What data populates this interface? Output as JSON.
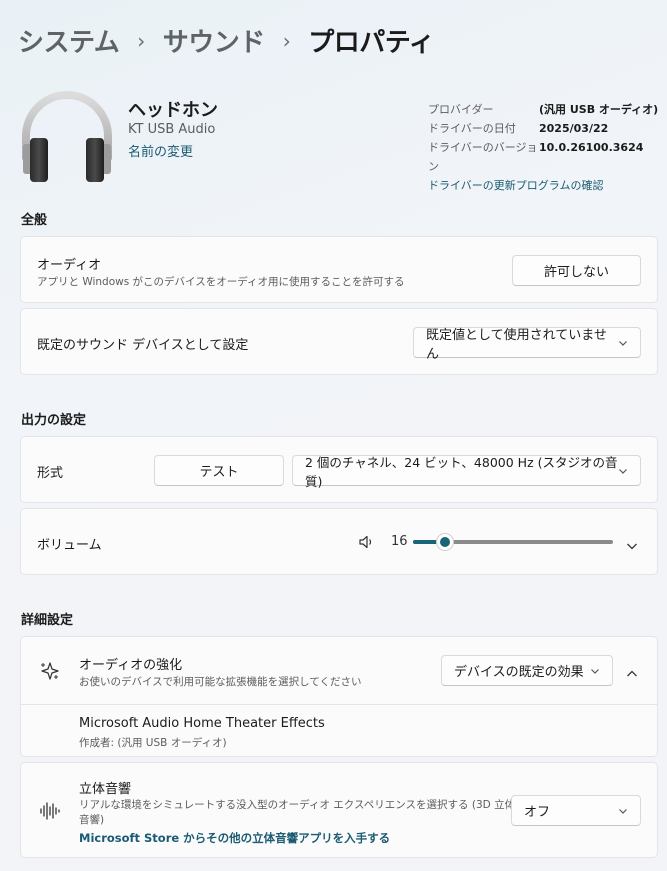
{
  "breadcrumb": {
    "item1": "システム",
    "item2": "サウンド",
    "current": "プロパティ",
    "separator": "›"
  },
  "device": {
    "name": "ヘッドホン",
    "model": "KT USB Audio",
    "rename_link": "名前の変更"
  },
  "properties": {
    "provider_label": "プロバイダー",
    "provider_value": "(汎用 USB オーディオ)",
    "date_label": "ドライバーの日付",
    "date_value": "2025/03/22",
    "version_label": "ドライバーのバージョン",
    "version_value": "10.0.26100.3624",
    "update_link": "ドライバーの更新プログラムの確認"
  },
  "general": {
    "heading": "全般",
    "audio_title": "オーディオ",
    "audio_desc": "アプリと Windows がこのデバイスをオーディオ用に使用することを許可する",
    "deny_button": "許可しない",
    "default_title": "既定のサウンド デバイスとして設定",
    "default_value": "既定値として使用されていません"
  },
  "output": {
    "heading": "出力の設定",
    "format_title": "形式",
    "test_button": "テスト",
    "format_value": "2 個のチャネル、24 ビット、48000 Hz (スタジオの音質)",
    "volume_title": "ボリューム",
    "volume_value": "16",
    "volume_level": 16
  },
  "advanced": {
    "heading": "詳細設定",
    "enh_title": "オーディオの強化",
    "enh_desc": "お使いのデバイスで利用可能な拡張機能を選択してください",
    "enh_value": "デバイスの既定の効果",
    "effect_name": "Microsoft Audio Home Theater Effects",
    "effect_author": "作成者: (汎用 USB オーディオ)",
    "spatial_title": "立体音響",
    "spatial_desc_1": "リアルな環境をシミュレートする没入型のオーディオ エクスペリエンスを選択する (3D 立体",
    "spatial_desc_2": "音響)",
    "spatial_link": "Microsoft Store からその他の立体音響アプリを入手する",
    "spatial_value": "オフ"
  },
  "colors": {
    "accent": "#1a6478",
    "link": "#1a5b73"
  }
}
